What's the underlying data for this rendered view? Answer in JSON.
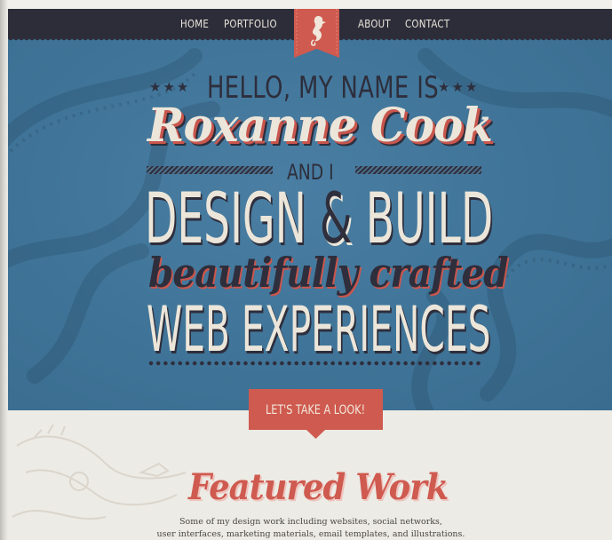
{
  "nav": {
    "items": [
      "HOME",
      "PORTFOLIO",
      "ABOUT",
      "CONTACT"
    ],
    "logo_icon": "seahorse-icon"
  },
  "hero": {
    "stars_left": "★★★",
    "stars_right": "★★★",
    "greeting": "HELLO, MY NAME IS",
    "name": "Roxanne Cook",
    "and_i": "AND I",
    "design": "DESIGN",
    "ampersand": "&",
    "build": "BUILD",
    "crafted": "beautifully crafted",
    "web_experiences": "WEB EXPERIENCES"
  },
  "cta": {
    "label": "LET'S TAKE A LOOK!"
  },
  "featured": {
    "title": "Featured Work",
    "line1": "Some of my design work including websites, social networks,",
    "line2": "user interfaces, marketing materials, email templates, and illustrations."
  },
  "colors": {
    "nav_bg": "#2d2d3a",
    "hero_bg": "#3f7498",
    "accent_red": "#cf5a4f",
    "cream": "#ece6da",
    "navy_text": "#2e2e3c"
  }
}
